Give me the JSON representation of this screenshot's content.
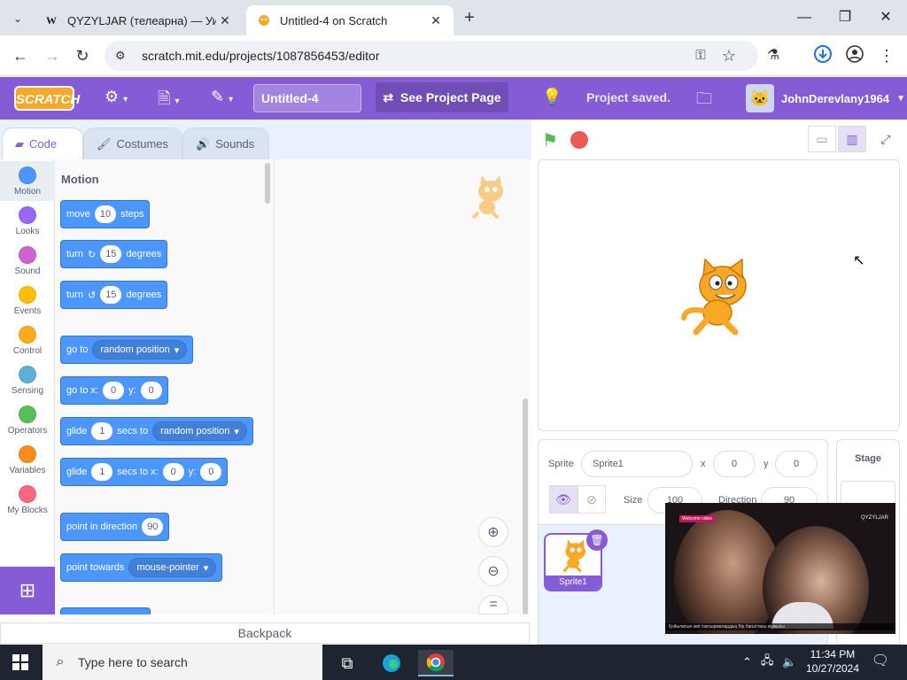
{
  "browser": {
    "tabs": [
      {
        "title": "QYZYLJAR (телеарна) — Уикип",
        "favicon": "W",
        "close": "✕"
      },
      {
        "title": "Untitled-4 on Scratch",
        "favicon": "scratch-cat",
        "close": "✕"
      }
    ],
    "new_tab": "+",
    "url": "scratch.mit.edu/projects/1087856453/editor"
  },
  "menubar": {
    "logo": "SCRATCH",
    "project_title": "Untitled-4",
    "see_project": "See Project Page",
    "status": "Project saved.",
    "username": "JohnDerevlany1964"
  },
  "editor_tabs": [
    {
      "label": "Code",
      "icon": "code-icon"
    },
    {
      "label": "Costumes",
      "icon": "brush-icon"
    },
    {
      "label": "Sounds",
      "icon": "speaker-icon"
    }
  ],
  "categories": [
    {
      "label": "Motion",
      "color": "#4c97ff"
    },
    {
      "label": "Looks",
      "color": "#9966ff"
    },
    {
      "label": "Sound",
      "color": "#cf63cf"
    },
    {
      "label": "Events",
      "color": "#ffbf00"
    },
    {
      "label": "Control",
      "color": "#ffab19"
    },
    {
      "label": "Sensing",
      "color": "#5cb1d6"
    },
    {
      "label": "Operators",
      "color": "#59c059"
    },
    {
      "label": "Variables",
      "color": "#ff8c1a"
    },
    {
      "label": "My Blocks",
      "color": "#ff6680"
    }
  ],
  "palette": {
    "section": "Motion",
    "blocks": {
      "move": {
        "w1": "move",
        "v1": "10",
        "w2": "steps"
      },
      "turn_right": {
        "w1": "turn",
        "v1": "15",
        "w2": "degrees"
      },
      "turn_left": {
        "w1": "turn",
        "v1": "15",
        "w2": "degrees"
      },
      "goto": {
        "w1": "go to",
        "d1": "random position"
      },
      "goto_xy": {
        "w1": "go to x:",
        "v1": "0",
        "w2": "y:",
        "v2": "0"
      },
      "glide_to": {
        "w1": "glide",
        "v1": "1",
        "w2": "secs to",
        "d1": "random position"
      },
      "glide_xy": {
        "w1": "glide",
        "v1": "1",
        "w2": "secs to x:",
        "v2": "0",
        "w3": "y:",
        "v3": "0"
      },
      "point_dir": {
        "w1": "point in direction",
        "v1": "90"
      },
      "point_towards": {
        "w1": "point towards",
        "d1": "mouse-pointer"
      }
    }
  },
  "backpack": "Backpack",
  "sprite_info": {
    "sprite_label": "Sprite",
    "sprite_name": "Sprite1",
    "x_label": "x",
    "x": "0",
    "y_label": "y",
    "y": "0",
    "size_label": "Size",
    "size": "100",
    "direction_label": "Direction",
    "direction": "90"
  },
  "sprite_list": [
    {
      "name": "Sprite1"
    }
  ],
  "stage_panel": {
    "title": "Stage"
  },
  "video": {
    "label": "Welcome video",
    "brand": "QYZYLJAR",
    "caption": "Қойылатын көп тапсырмалардың бір бағыттағы жұмысы"
  },
  "taskbar": {
    "search_placeholder": "Type here to search",
    "time": "11:34 PM",
    "date": "10/27/2024"
  },
  "colors": {
    "scratch_purple": "#855cd6",
    "motion_blue": "#4c97ff",
    "flag_green": "#4cbf56",
    "stop_red": "#ec5959"
  }
}
